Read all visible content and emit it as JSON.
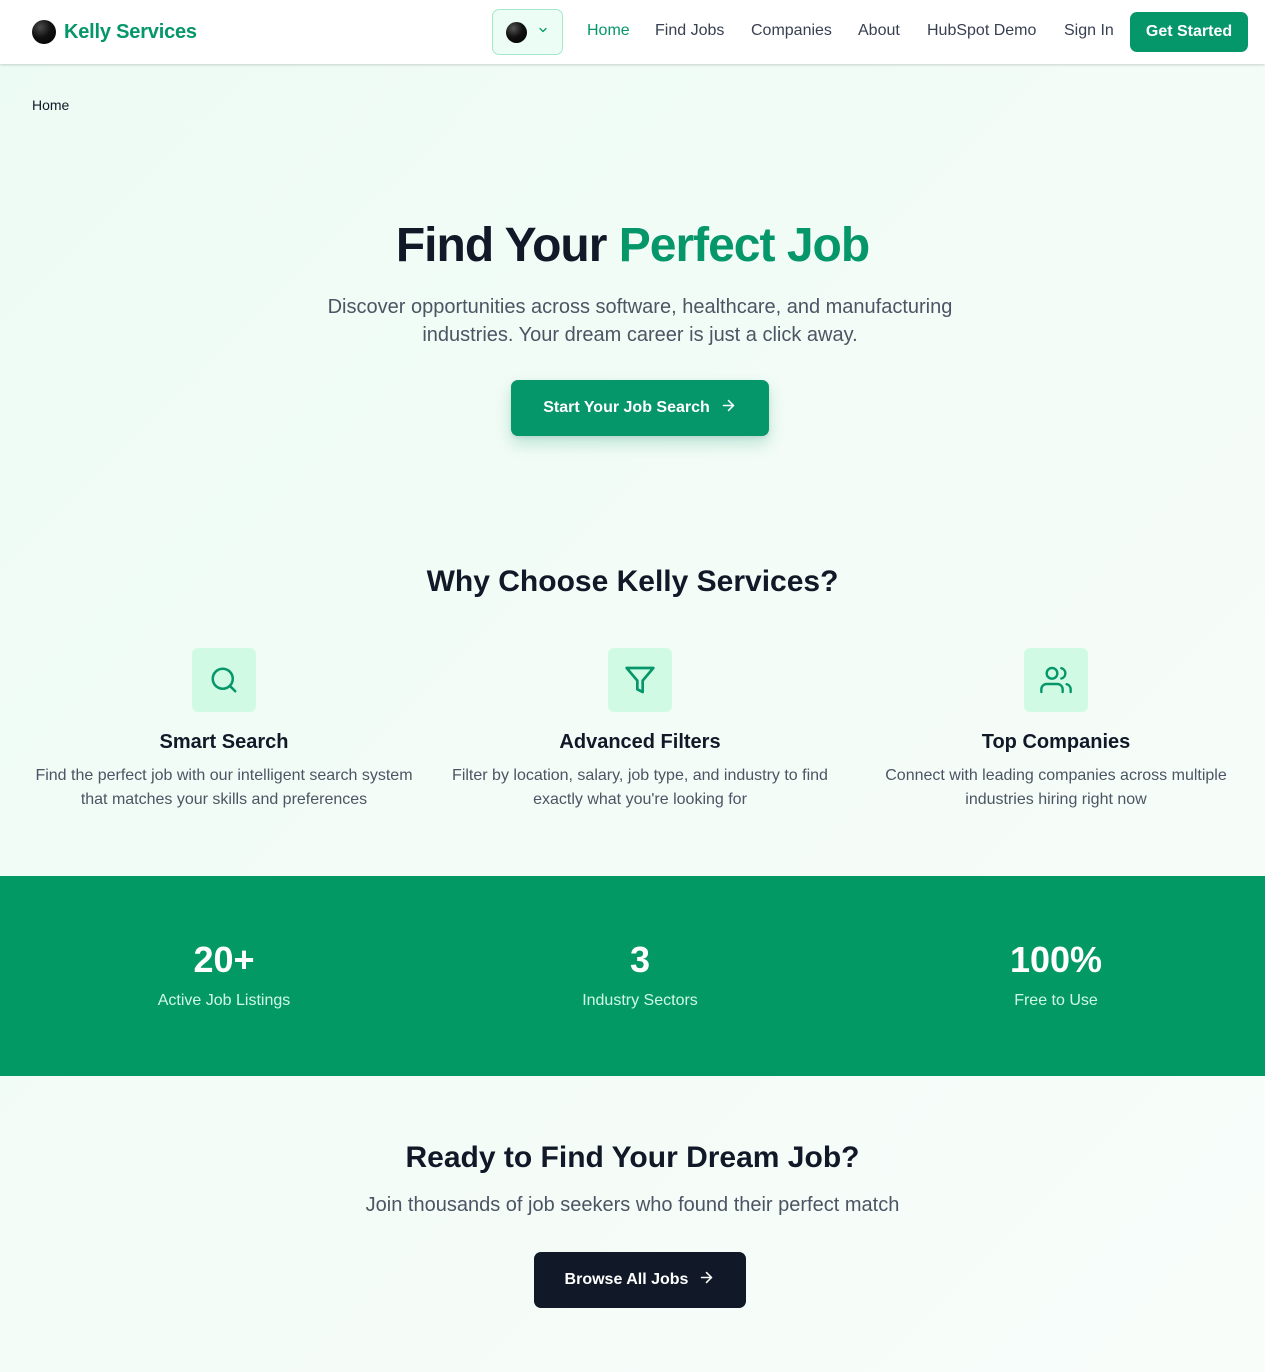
{
  "header": {
    "brand_name": "Kelly Services",
    "nav": [
      {
        "label": "Home",
        "active": true
      },
      {
        "label": "Find Jobs",
        "active": false
      },
      {
        "label": "Companies",
        "active": false
      },
      {
        "label": "About",
        "active": false
      },
      {
        "label": "HubSpot Demo",
        "active": false
      },
      {
        "label": "Sign In",
        "active": false
      }
    ],
    "cta_label": "Get Started",
    "theme_icon": "dark-mode-dot-icon"
  },
  "breadcrumb": "Home",
  "hero": {
    "title_plain": "Find Your",
    "title_accent": "Perfect Job",
    "subtitle": "Discover opportunities across software, healthcare, and manufacturing industries. Your dream career is just a click away.",
    "cta_label": "Start Your Job Search"
  },
  "why": {
    "title": "Why Choose Kelly Services?",
    "features": [
      {
        "icon": "search-icon",
        "title": "Smart Search",
        "description": "Find the perfect job with our intelligent search system that matches your skills and preferences"
      },
      {
        "icon": "filter-icon",
        "title": "Advanced Filters",
        "description": "Filter by location, salary, job type, and industry to find exactly what you're looking for"
      },
      {
        "icon": "users-icon",
        "title": "Top Companies",
        "description": "Connect with leading companies across multiple industries hiring right now"
      }
    ]
  },
  "stats": [
    {
      "value": "20+",
      "label": "Active Job Listings"
    },
    {
      "value": "3",
      "label": "Industry Sectors"
    },
    {
      "value": "100%",
      "label": "Free to Use"
    }
  ],
  "cta": {
    "title": "Ready to Find Your Dream Job?",
    "subtitle": "Join thousands of job seekers who found their perfect match",
    "button_label": "Browse All Jobs"
  },
  "colors": {
    "brand_green": "#059669",
    "band_green": "#039965",
    "dark": "#111827",
    "icon_bg": "#d1fae5"
  }
}
